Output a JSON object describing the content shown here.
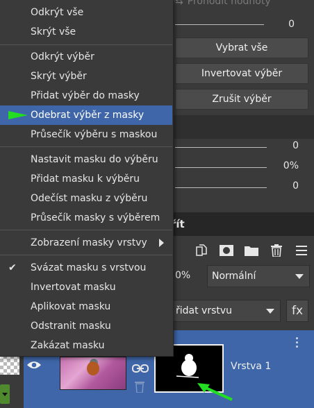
{
  "right_panel": {
    "top_button_faded": "Prohodit hodnoty",
    "slider_values": [
      "0",
      "0",
      "0%",
      "0"
    ],
    "buttons": [
      "Vybrat vše",
      "Invertovat výběr",
      "Zrušit výběr"
    ],
    "section_title_partial": "řít",
    "opacity_partial": "0%",
    "blend_mode": "Normální",
    "add_layer_partial": "řidat vrstvu",
    "fx_label": "fx"
  },
  "layer": {
    "name": "Vrstva 1"
  },
  "context_menu": {
    "group1": [
      "Odkrýt vše",
      "Skrýt vše"
    ],
    "group2": [
      "Odkrýt výběr",
      "Skrýt výběr",
      "Přidat výběr do masky",
      "Odebrat výběr z masky",
      "Průsečík výběru s maskou"
    ],
    "highlighted_item": "Odebrat výběr z masky",
    "group3": [
      "Nastavit masku do výběru",
      "Přidat masku k výběru",
      "Odečíst masku z výběru",
      "Průsečík masky s výběrem"
    ],
    "group4": [
      "Zobrazení masky vrstvy"
    ],
    "group5": [
      "Svázat masku s vrstvou",
      "Invertovat masku",
      "Aplikovat masku",
      "Odstranit masku",
      "Zakázat masku"
    ],
    "checked_item": "Svázat masku s vrstvou"
  },
  "colors": {
    "highlight": "#3e66a8",
    "annotation_arrow": "#22dd22",
    "layer_selected": "#3e66a8"
  }
}
